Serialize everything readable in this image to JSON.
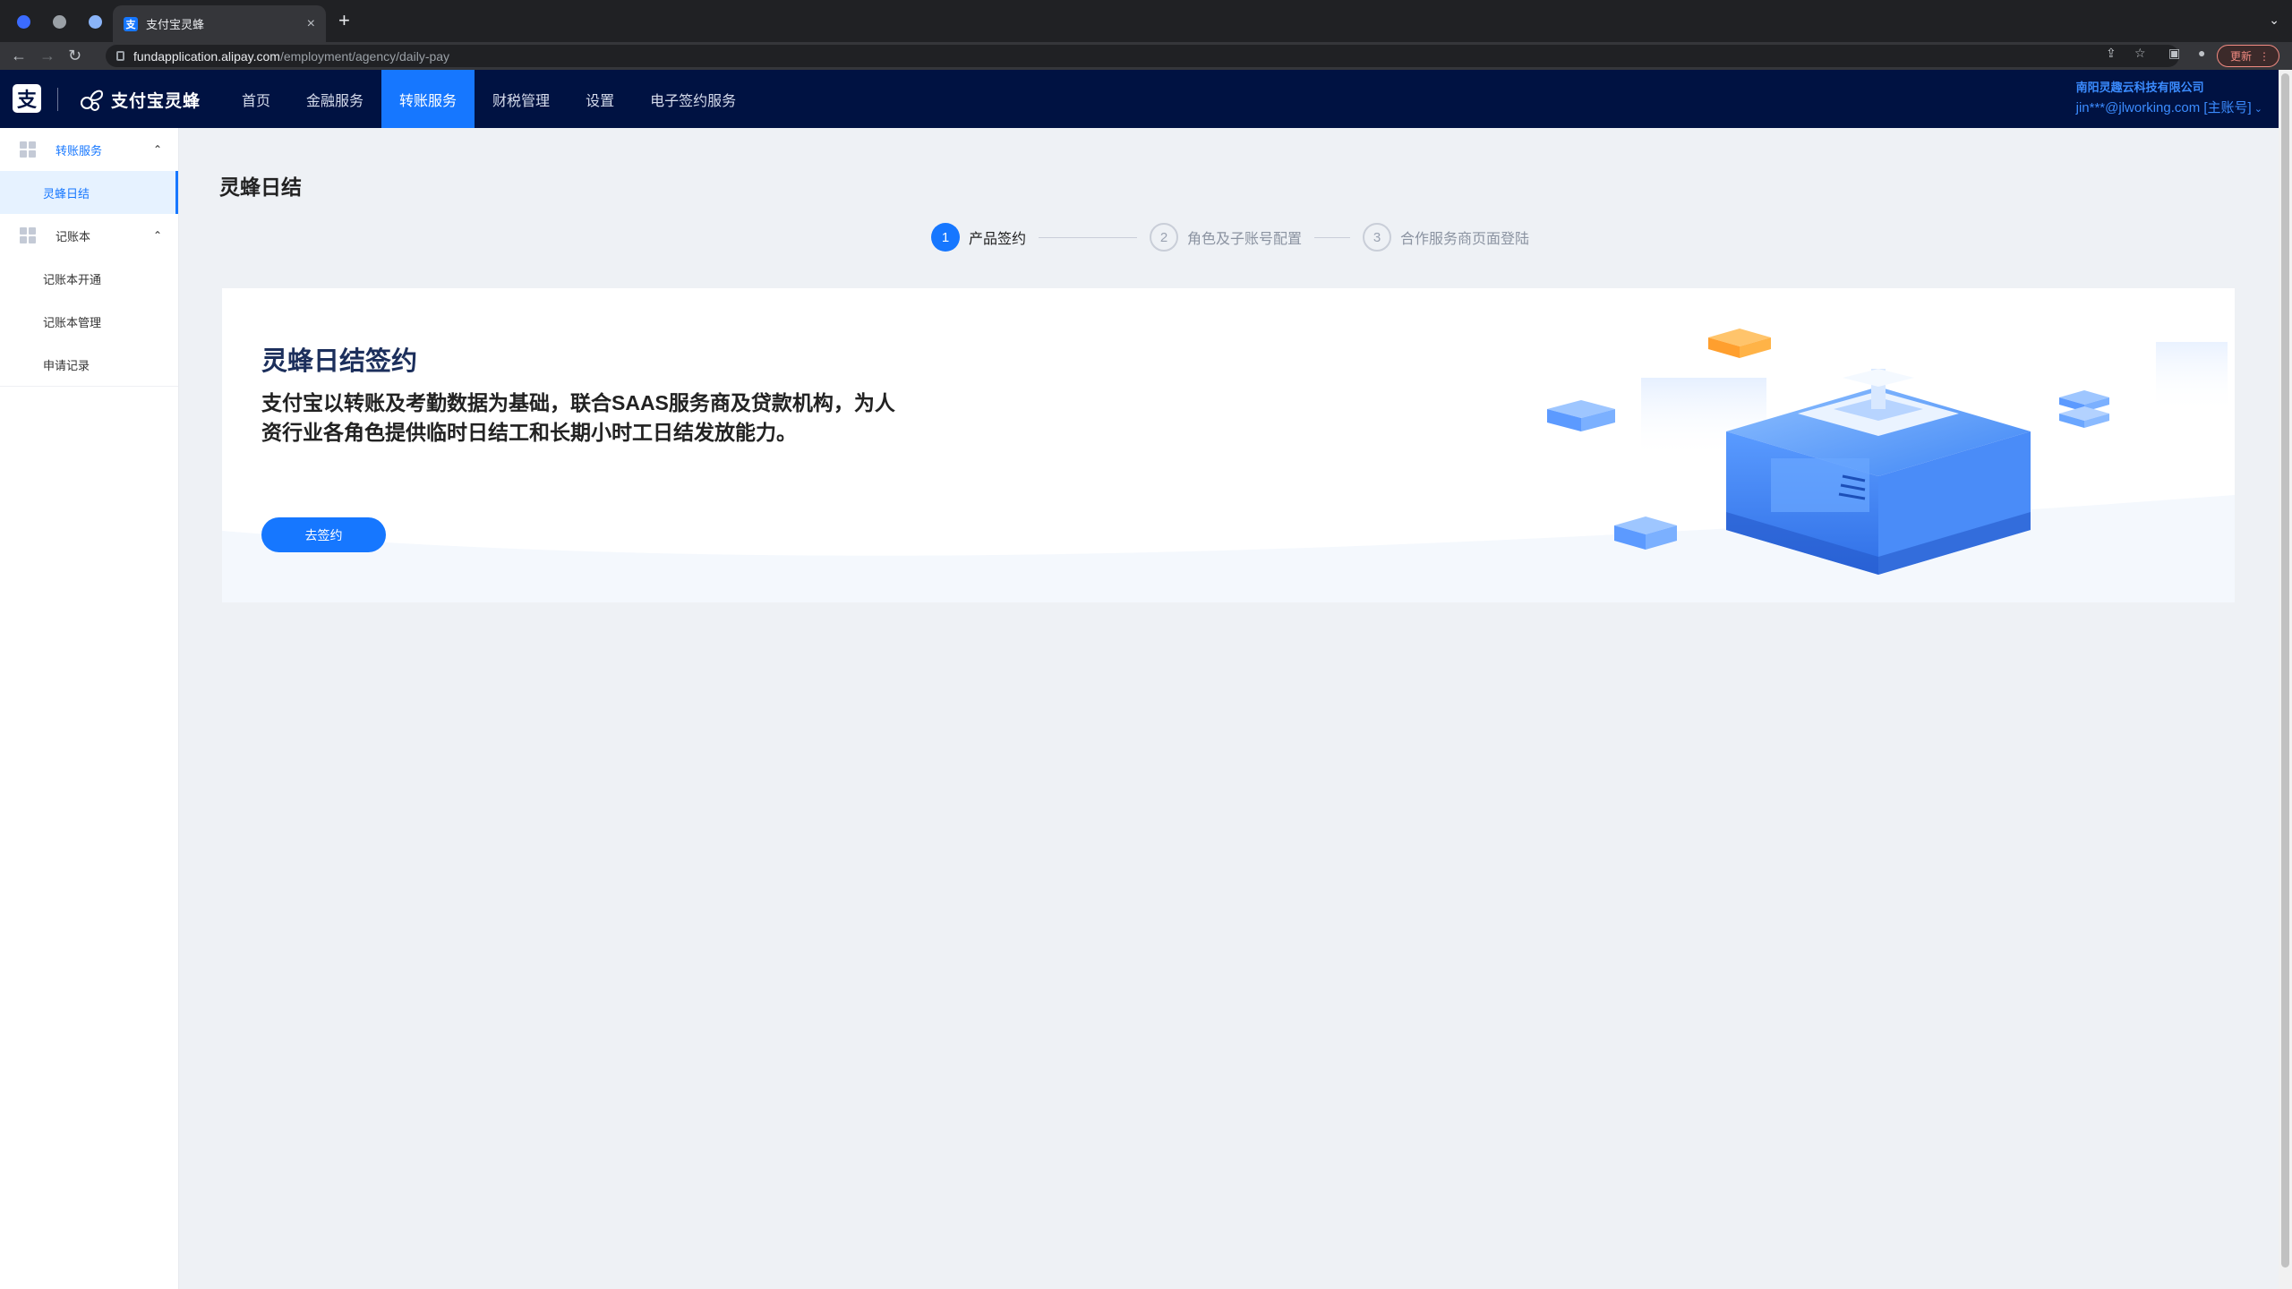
{
  "browser": {
    "tab_title": "支付宝灵蜂",
    "url_host": "fundapplication.alipay.com",
    "url_path": "/employment/agency/daily-pay",
    "update_label": "更新"
  },
  "header": {
    "logo_glyph": "支",
    "brand": "支付宝灵蜂",
    "nav": [
      "首页",
      "金融服务",
      "转账服务",
      "财税管理",
      "设置",
      "电子签约服务"
    ],
    "active_nav": "转账服务",
    "company": "南阳灵趣云科技有限公司",
    "user": "jin***@jlworking.com [主账号]"
  },
  "sidebar": {
    "groups": [
      {
        "label": "转账服务",
        "items": [
          "灵蜂日结"
        ]
      },
      {
        "label": "记账本",
        "items": [
          "记账本开通",
          "记账本管理",
          "申请记录"
        ]
      }
    ]
  },
  "main": {
    "title": "灵蜂日结",
    "steps": [
      {
        "num": "1",
        "label": "产品签约"
      },
      {
        "num": "2",
        "label": "角色及子账号配置"
      },
      {
        "num": "3",
        "label": "合作服务商页面登陆"
      }
    ],
    "card": {
      "title": "灵蜂日结签约",
      "desc": "支付宝以转账及考勤数据为基础，联合SAAS服务商及贷款机构，为人资行业各角色提供临时日结工和长期小时工日结发放能力。",
      "button": "去签约"
    }
  },
  "colors": {
    "accent": "#1677ff",
    "header_bg": "#001242"
  }
}
